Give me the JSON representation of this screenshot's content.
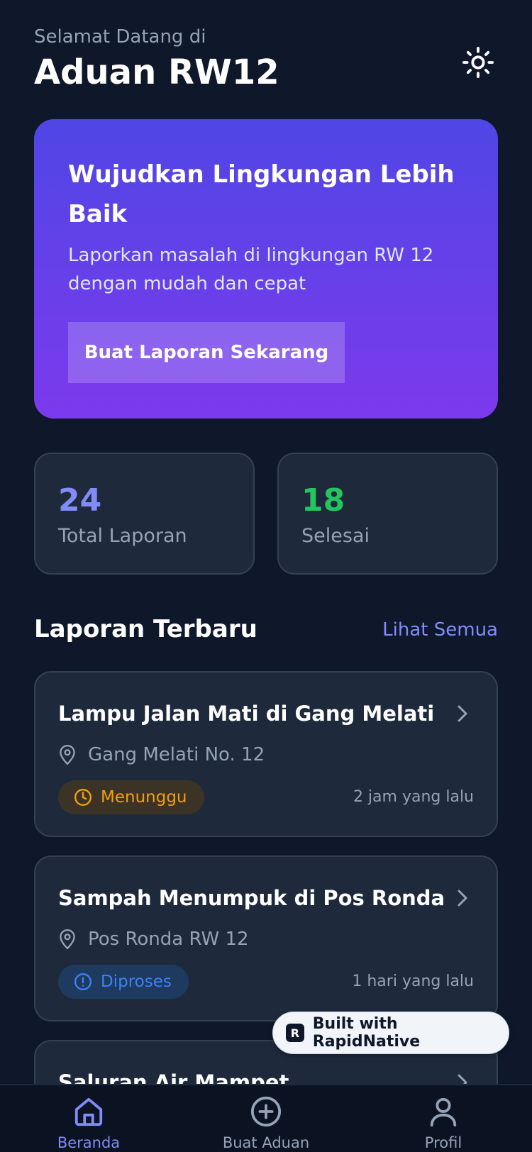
{
  "header": {
    "welcome": "Selamat Datang di",
    "title": "Aduan RW12"
  },
  "hero": {
    "title": "Wujudkan Lingkungan Lebih Baik",
    "subtitle": "Laporkan masalah di lingkungan RW 12 dengan mudah dan cepat",
    "button_label": "Buat Laporan Sekarang"
  },
  "stats": [
    {
      "value": "24",
      "label": "Total Laporan",
      "color": "#818cf8"
    },
    {
      "value": "18",
      "label": "Selesai",
      "color": "#22c55e"
    }
  ],
  "section": {
    "title": "Laporan Terbaru",
    "see_all": "Lihat Semua"
  },
  "reports": [
    {
      "title": "Lampu Jalan Mati di Gang Melati",
      "location": "Gang Melati No. 12",
      "status": "Menunggu",
      "status_icon": "clock-icon",
      "time": "2 jam yang lalu"
    },
    {
      "title": "Sampah Menumpuk di Pos Ronda",
      "location": "Pos Ronda RW 12",
      "status": "Diproses",
      "status_icon": "alert-circle-icon",
      "time": "1 hari yang lalu"
    },
    {
      "title": "Saluran Air Mampet"
    }
  ],
  "branding": {
    "label": "Built with RapidNative"
  },
  "tabs": [
    {
      "label": "Beranda",
      "icon": "home-icon",
      "active": true
    },
    {
      "label": "Buat Aduan",
      "icon": "plus-circle-icon",
      "active": false
    },
    {
      "label": "Profil",
      "icon": "user-icon",
      "active": false
    }
  ],
  "colors": {
    "background": "#0f172a",
    "card": "#1e293b",
    "accent": "#818cf8",
    "success": "#22c55e",
    "warning": "#f59e0b",
    "info": "#3b82f6"
  }
}
